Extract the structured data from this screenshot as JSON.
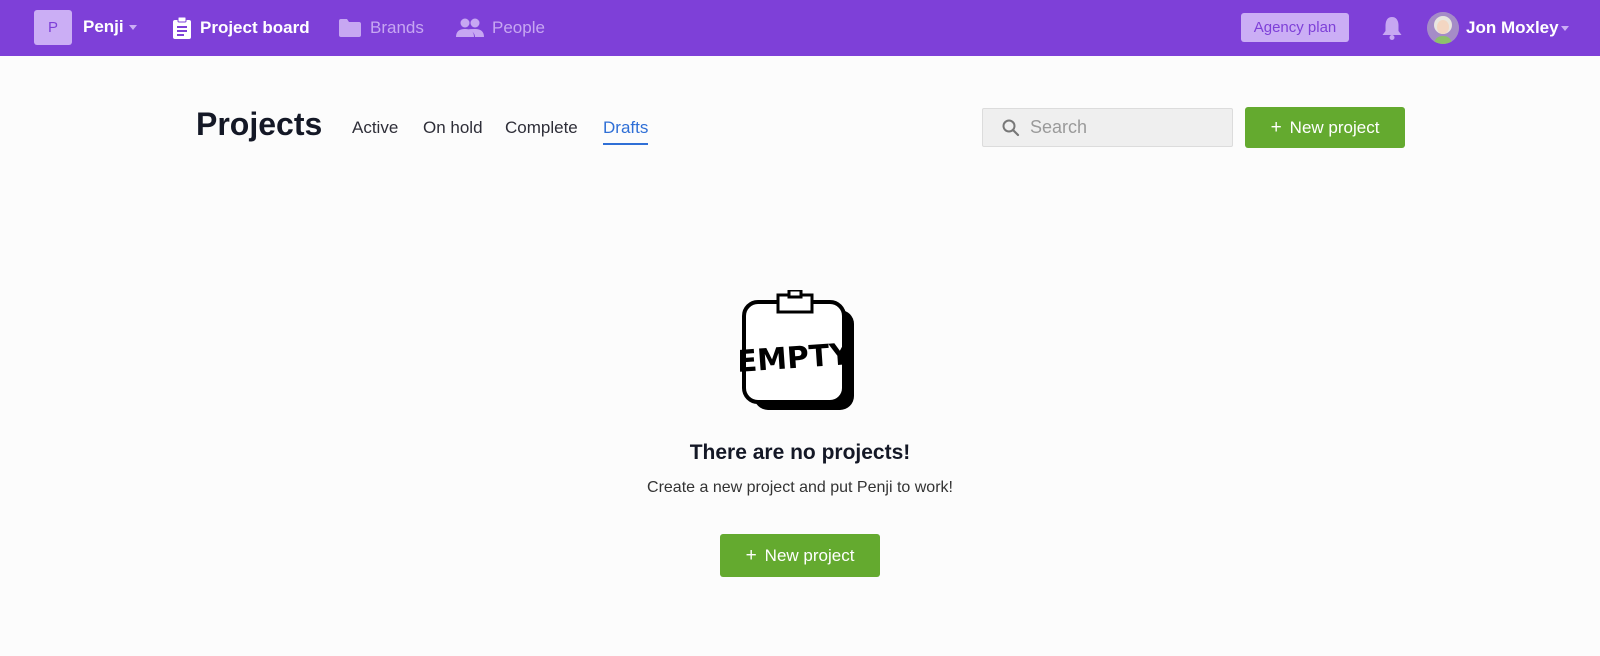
{
  "topbar": {
    "brand_initial": "P",
    "brand_name": "Penji",
    "nav": [
      {
        "label": "Project board",
        "icon": "clipboard-icon",
        "active": true
      },
      {
        "label": "Brands",
        "icon": "folder-icon",
        "active": false
      },
      {
        "label": "People",
        "icon": "people-icon",
        "active": false
      }
    ],
    "plan_badge": "Agency plan",
    "user_name": "Jon Moxley"
  },
  "page": {
    "title": "Projects",
    "tabs": [
      {
        "label": "Active",
        "active": false
      },
      {
        "label": "On hold",
        "active": false
      },
      {
        "label": "Complete",
        "active": false
      },
      {
        "label": "Drafts",
        "active": true
      }
    ],
    "search_placeholder": "Search",
    "new_project_label": "New project",
    "plus_glyph": "+"
  },
  "empty_state": {
    "image_text": "EMPTY",
    "title": "There are no projects!",
    "subtitle": "Create a new project and put Penji to work!",
    "button_label": "New project"
  },
  "colors": {
    "topbar": "#7e40d8",
    "accent_light": "#cbaef5",
    "active_tab": "#2f6fd6",
    "primary_button": "#64aa2f"
  }
}
